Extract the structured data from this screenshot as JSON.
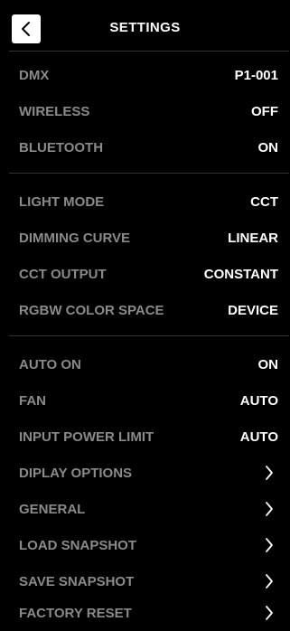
{
  "header": {
    "title": "SETTINGS",
    "back_icon": "chevron-left-icon"
  },
  "groups": {
    "connectivity": [
      {
        "label": "DMX",
        "value": "P1-001"
      },
      {
        "label": "WIRELESS",
        "value": "OFF"
      },
      {
        "label": "BLUETOOTH",
        "value": "ON"
      }
    ],
    "light": [
      {
        "label": "LIGHT MODE",
        "value": "CCT"
      },
      {
        "label": "DIMMING CURVE",
        "value": "LINEAR"
      },
      {
        "label": "CCT OUTPUT",
        "value": "CONSTANT"
      },
      {
        "label": "RGBW COLOR SPACE",
        "value": "DEVICE"
      }
    ],
    "system": [
      {
        "label": "AUTO ON",
        "value": "ON"
      },
      {
        "label": "FAN",
        "value": "AUTO"
      },
      {
        "label": "INPUT POWER LIMIT",
        "value": "AUTO"
      },
      {
        "label": "DIPLAY OPTIONS",
        "icon": "chevron-right-icon"
      },
      {
        "label": "GENERAL",
        "icon": "chevron-right-icon"
      },
      {
        "label": "LOAD SNAPSHOT",
        "icon": "chevron-right-icon"
      },
      {
        "label": "SAVE SNAPSHOT",
        "icon": "chevron-right-icon"
      },
      {
        "label": "FACTORY RESET",
        "icon": "chevron-right-icon"
      }
    ]
  },
  "colors": {
    "background": "#000000",
    "label": "#8a8a8a",
    "value": "#ffffff",
    "divider": "#333333"
  }
}
